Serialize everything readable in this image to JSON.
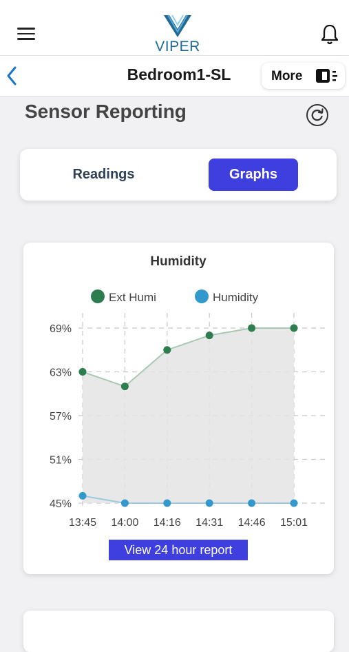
{
  "header": {
    "logo_text": "VIPER",
    "menu_icon": "hamburger-menu-icon",
    "notification_icon": "bell-icon"
  },
  "nav": {
    "title": "Bedroom1-SL",
    "back_icon": "chevron-left-icon",
    "more_label": "More",
    "more_icon": "panel-menu-icon"
  },
  "section": {
    "title": "Sensor Reporting",
    "refresh_icon": "refresh-icon"
  },
  "tabs": [
    {
      "label": "Readings",
      "active": false
    },
    {
      "label": "Graphs",
      "active": true
    }
  ],
  "report_button": "View 24 hour report",
  "colors": {
    "accent": "#3f3fe0",
    "ext_humi": "#2e7d4f",
    "humidity": "#3399cc"
  },
  "chart_data": {
    "type": "area",
    "title": "Humidity",
    "xlabel": "",
    "ylabel": "",
    "categories": [
      "13:45",
      "14:00",
      "14:16",
      "14:31",
      "14:46",
      "15:01"
    ],
    "y_ticks": [
      "69%",
      "63%",
      "57%",
      "51%",
      "45%"
    ],
    "ylim": [
      45,
      69
    ],
    "grid": true,
    "legend": "top",
    "series": [
      {
        "name": "Ext Humi",
        "values": [
          63.0,
          61.0,
          66.0,
          68.0,
          69.0,
          69.0
        ]
      },
      {
        "name": "Humidity",
        "values": [
          46.0,
          45.0,
          45.0,
          45.0,
          45.0,
          45.0
        ]
      }
    ]
  }
}
